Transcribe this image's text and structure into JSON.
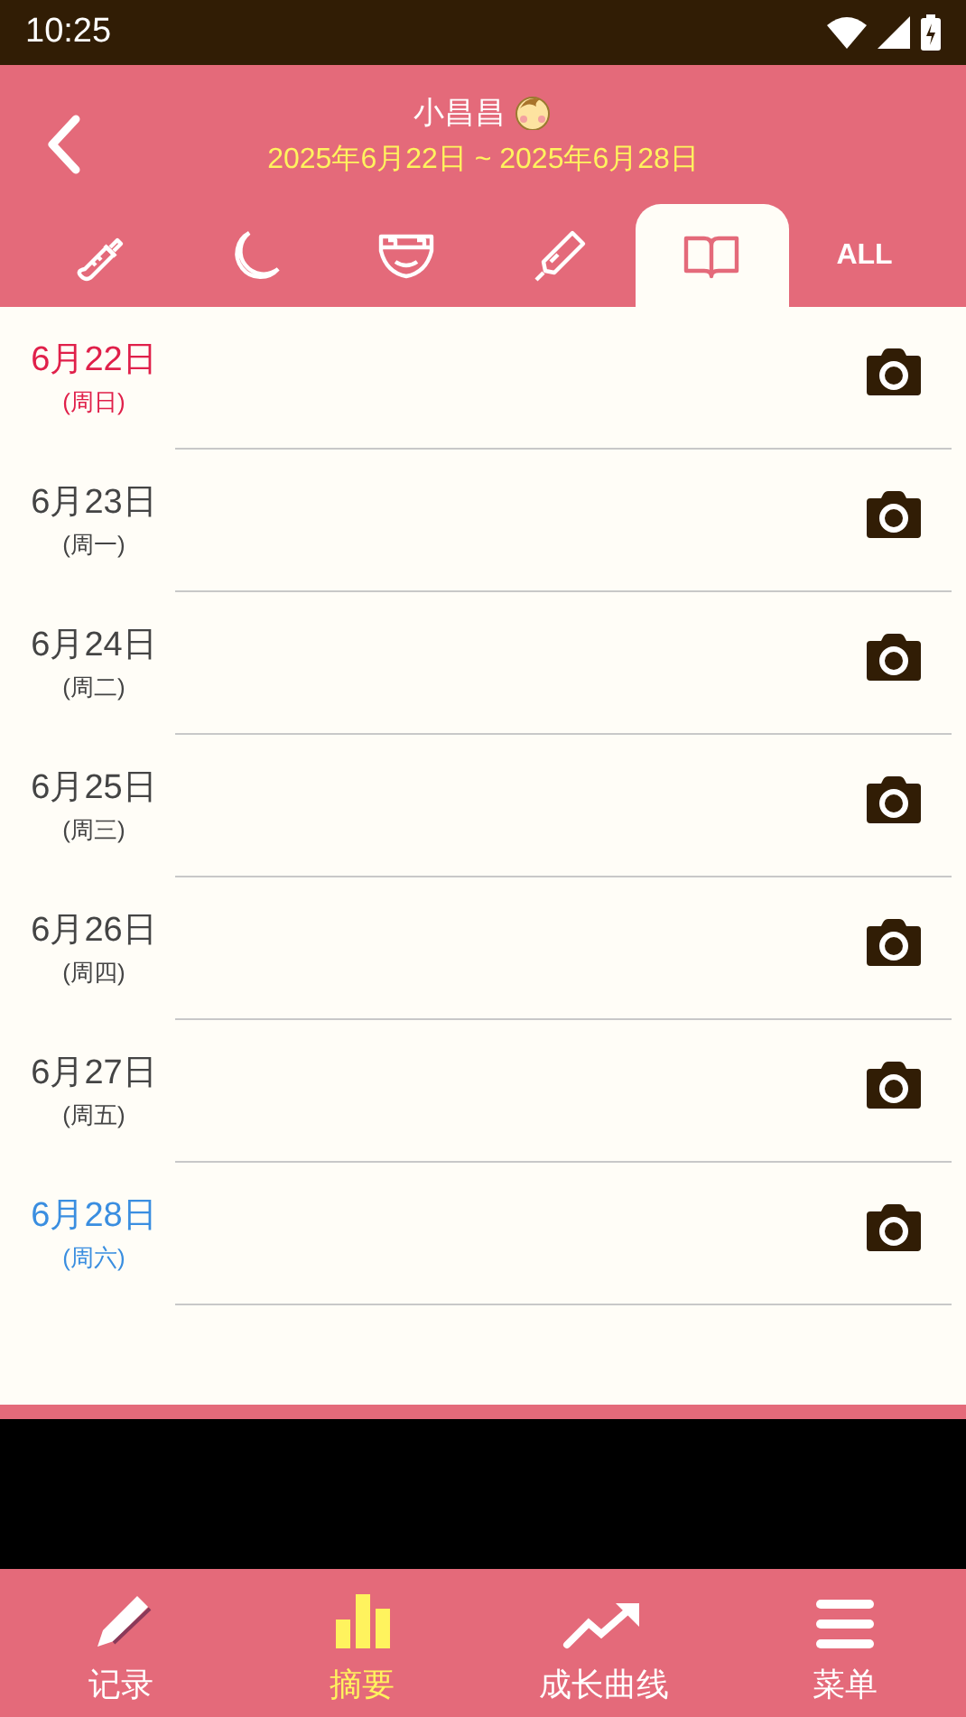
{
  "status_bar": {
    "time": "10:25"
  },
  "header": {
    "title": "小昌昌",
    "date_range": "2025年6月22日 ~ 2025年6月28日"
  },
  "tabs": [
    {
      "kind": "bottle",
      "selected": false
    },
    {
      "kind": "moon",
      "selected": false
    },
    {
      "kind": "diaper",
      "selected": false
    },
    {
      "kind": "thermometer",
      "selected": false
    },
    {
      "kind": "book",
      "selected": true
    },
    {
      "kind": "text",
      "label": "ALL",
      "selected": false
    }
  ],
  "days": [
    {
      "date": "6月22日",
      "weekday": "(周日)",
      "color": "#e0204a"
    },
    {
      "date": "6月23日",
      "weekday": "(周一)",
      "color": "#444444"
    },
    {
      "date": "6月24日",
      "weekday": "(周二)",
      "color": "#444444"
    },
    {
      "date": "6月25日",
      "weekday": "(周三)",
      "color": "#444444"
    },
    {
      "date": "6月26日",
      "weekday": "(周四)",
      "color": "#444444"
    },
    {
      "date": "6月27日",
      "weekday": "(周五)",
      "color": "#444444"
    },
    {
      "date": "6月28日",
      "weekday": "(周六)",
      "color": "#3a8ee0"
    }
  ],
  "bottom_nav": [
    {
      "kind": "pencil",
      "label": "记录",
      "selected": false
    },
    {
      "kind": "bars",
      "label": "摘要",
      "selected": true
    },
    {
      "kind": "trend",
      "label": "成长曲线",
      "selected": false
    },
    {
      "kind": "menu",
      "label": "菜单",
      "selected": false
    }
  ]
}
